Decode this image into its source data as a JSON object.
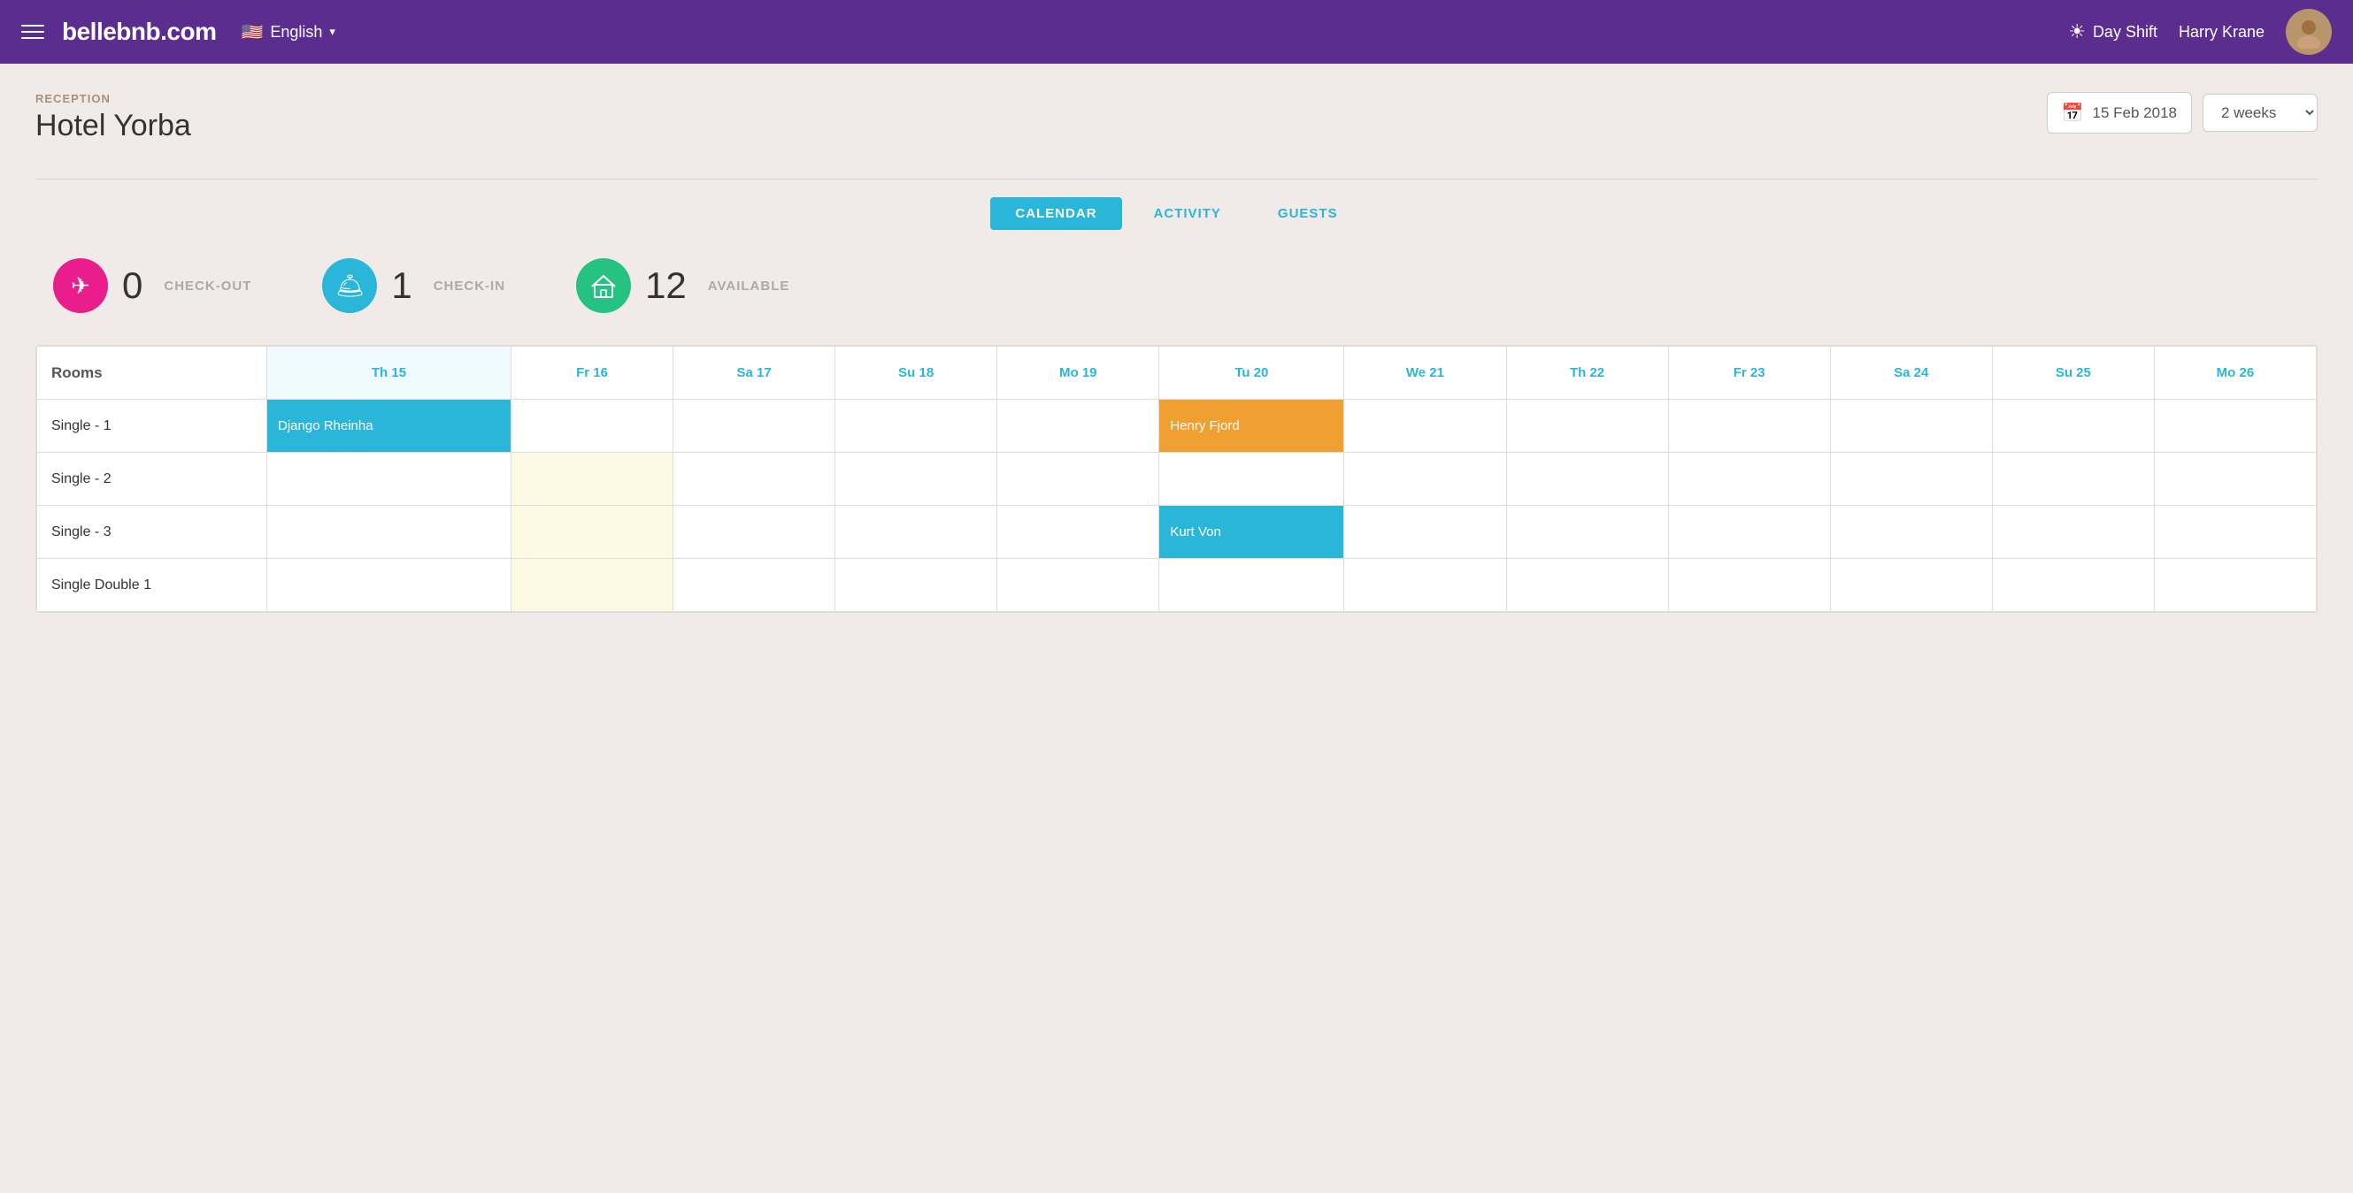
{
  "header": {
    "logo": "bellebnb.com",
    "lang_flag": "🇺🇸",
    "lang_label": "English",
    "shift_label": "Day Shift",
    "user_name": "Harry Krane",
    "avatar_initials": "👤"
  },
  "breadcrumb": "RECEPTION",
  "hotel_name": "Hotel Yorba",
  "date_value": "15 Feb 2018",
  "weeks_option": "2 weeks",
  "tabs": [
    {
      "id": "calendar",
      "label": "CALENDAR",
      "active": true
    },
    {
      "id": "activity",
      "label": "ACTIVITY",
      "active": false
    },
    {
      "id": "guests",
      "label": "GUESTS",
      "active": false
    }
  ],
  "stats": [
    {
      "id": "checkout",
      "icon": "✈",
      "color": "pink",
      "count": "0",
      "label": "CHECK-OUT"
    },
    {
      "id": "checkin",
      "icon": "🛎",
      "color": "blue",
      "count": "1",
      "label": "CHECK-IN"
    },
    {
      "id": "available",
      "icon": "🏠",
      "color": "green",
      "count": "12",
      "label": "AVAILABLE"
    }
  ],
  "calendar": {
    "rooms_header": "Rooms",
    "days": [
      {
        "label": "Th 15",
        "today": true
      },
      {
        "label": "Fr 16",
        "today": false
      },
      {
        "label": "Sa 17",
        "today": false
      },
      {
        "label": "Su 18",
        "today": false
      },
      {
        "label": "Mo 19",
        "today": false
      },
      {
        "label": "Tu 20",
        "today": false
      },
      {
        "label": "We 21",
        "today": false
      },
      {
        "label": "Th 22",
        "today": false
      },
      {
        "label": "Fr 23",
        "today": false
      },
      {
        "label": "Sa 24",
        "today": false
      },
      {
        "label": "Su 25",
        "today": false
      },
      {
        "label": "Mo 26",
        "today": false
      }
    ],
    "rows": [
      {
        "room": "Single - 1",
        "cells": [
          "booking-cyan:Django Rheinha",
          "",
          "",
          "",
          "",
          "booking-orange:Henry Fjord",
          "",
          "",
          "",
          "",
          "",
          ""
        ]
      },
      {
        "room": "Single - 2",
        "cells": [
          "",
          "yellow",
          "",
          "",
          "",
          "",
          "",
          "",
          "",
          "",
          "",
          ""
        ]
      },
      {
        "room": "Single - 3",
        "cells": [
          "",
          "yellow",
          "",
          "",
          "",
          "booking-cyan2:Kurt Von",
          "",
          "",
          "",
          "",
          "",
          ""
        ]
      },
      {
        "room": "Single Double 1",
        "cells": [
          "",
          "yellow",
          "",
          "",
          "",
          "",
          "",
          "",
          "",
          "",
          "",
          ""
        ]
      }
    ]
  }
}
